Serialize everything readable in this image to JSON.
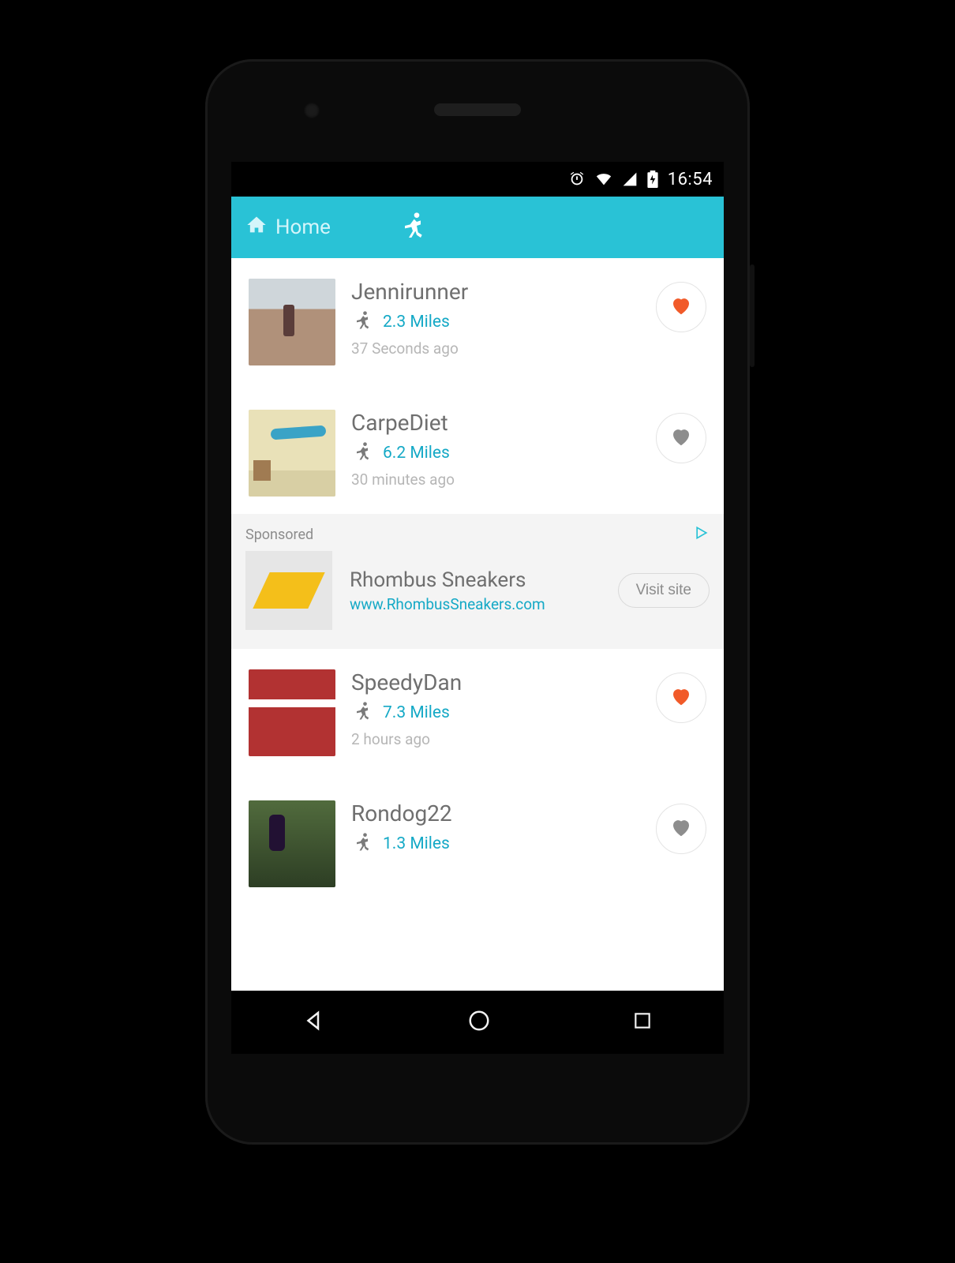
{
  "status": {
    "time": "16:54"
  },
  "appbar": {
    "home_label": "Home"
  },
  "feed": [
    {
      "username": "Jennirunner",
      "miles": "2.3 Miles",
      "time": "37 Seconds ago",
      "liked": true,
      "scene": "sc1"
    },
    {
      "username": "CarpeDiet",
      "miles": "6.2 Miles",
      "time": "30 minutes ago",
      "liked": false,
      "scene": "sc2"
    },
    {
      "username": "SpeedyDan",
      "miles": "7.3 Miles",
      "time": "2 hours ago",
      "liked": true,
      "scene": "sc3"
    },
    {
      "username": "Rondog22",
      "miles": "1.3 Miles",
      "time": "",
      "liked": false,
      "scene": "sc4"
    }
  ],
  "ad": {
    "sponsored_label": "Sponsored",
    "title": "Rhombus Sneakers",
    "url": "www.RhombusSneakers.com",
    "cta": "Visit site"
  },
  "colors": {
    "accent": "#29c2d6",
    "link": "#15a9c6",
    "heart_on": "#f15a29",
    "heart_off": "#8d8d8d"
  }
}
